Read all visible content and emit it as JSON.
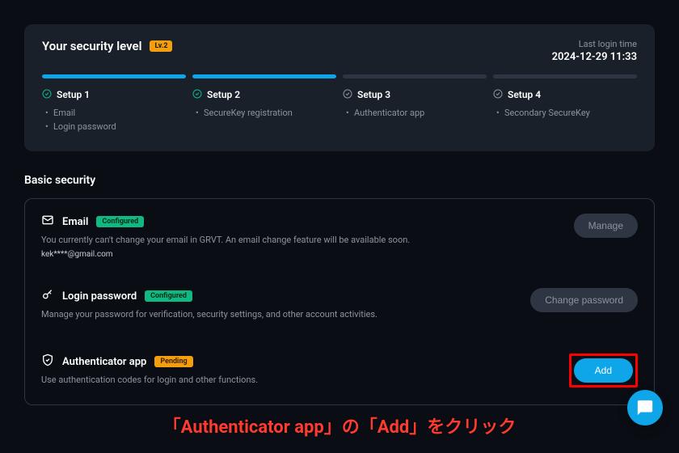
{
  "securityPanel": {
    "title": "Your security level",
    "levelBadge": "Lv.2",
    "lastLoginLabel": "Last login time",
    "lastLoginTime": "2024-12-29 11:33",
    "steps": [
      {
        "title": "Setup 1",
        "progress": 100,
        "complete": true,
        "items": [
          "Email",
          "Login password"
        ]
      },
      {
        "title": "Setup 2",
        "progress": 100,
        "complete": true,
        "items": [
          "SecureKey registration"
        ]
      },
      {
        "title": "Setup 3",
        "progress": 0,
        "complete": false,
        "items": [
          "Authenticator app"
        ]
      },
      {
        "title": "Setup 4",
        "progress": 0,
        "complete": false,
        "items": [
          "Secondary SecureKey"
        ]
      }
    ]
  },
  "basicSecurity": {
    "heading": "Basic security",
    "items": [
      {
        "icon": "mail",
        "name": "Email",
        "status": "Configured",
        "statusClass": "configured",
        "desc": "You currently can't change your email in GRVT. An email change feature will be available soon.",
        "extra": "kek****@gmail.com",
        "buttonLabel": "Manage",
        "buttonPrimary": false,
        "highlight": false
      },
      {
        "icon": "key",
        "name": "Login password",
        "status": "Configured",
        "statusClass": "configured",
        "desc": "Manage your password for verification, security settings, and other account activities.",
        "extra": "",
        "buttonLabel": "Change password",
        "buttonPrimary": false,
        "highlight": false
      },
      {
        "icon": "shield",
        "name": "Authenticator app",
        "status": "Pending",
        "statusClass": "pending",
        "desc": "Use authentication codes for login and other functions.",
        "extra": "",
        "buttonLabel": "Add",
        "buttonPrimary": true,
        "highlight": true
      }
    ]
  },
  "annotation": "「Authenticator app」の「Add」をクリック",
  "colors": {
    "accent": "#0ea5e9",
    "success": "#10b981",
    "warning": "#f59e0b",
    "highlight": "#ff0000"
  }
}
